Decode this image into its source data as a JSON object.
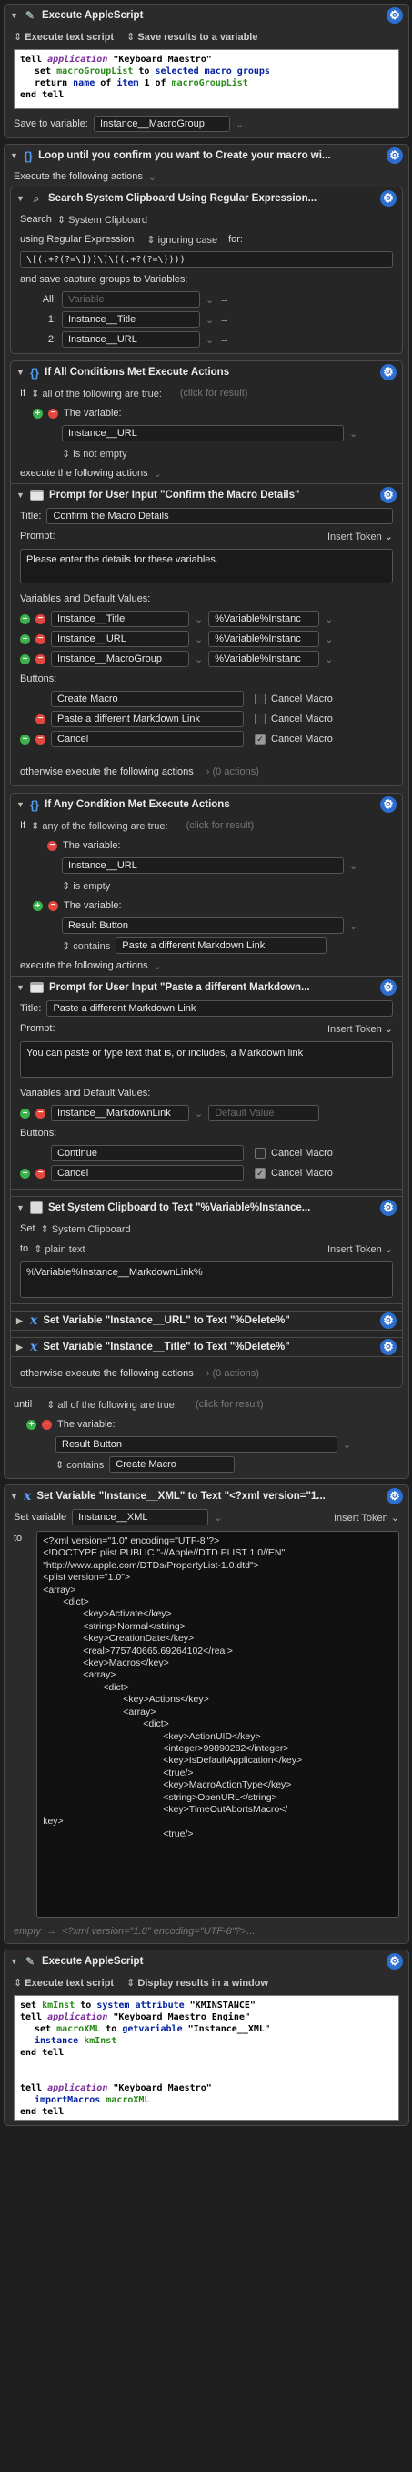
{
  "a1": {
    "title": "Execute AppleScript",
    "opt1": "Execute text script",
    "opt2": "Save results to a variable",
    "save_label": "Save to variable:",
    "save_var": "Instance__MacroGroup",
    "code": [
      "tell application \"Keyboard Maestro\"",
      "set macroGroupList to selected macro groups",
      "return name of item 1 of macroGroupList",
      "end tell"
    ]
  },
  "loop": {
    "title": "Loop until you confirm you want to Create your macro wi...",
    "exec": "Execute the following actions",
    "until_label": "until",
    "until_mode": "all of the following are true:",
    "click_result": "(click for result)",
    "var_label": "The variable:",
    "var": "Result Button",
    "op": "contains",
    "value": "Create Macro"
  },
  "search": {
    "title": "Search System Clipboard Using Regular Expression...",
    "search_label": "Search",
    "search_src": "System Clipboard",
    "using": "using Regular Expression",
    "ign": "ignoring case",
    "for": "for:",
    "regex": "\\[(.+?(?=\\]))\\]\\((.+?(?=\\))))",
    "save_caps": "and save capture groups to Variables:",
    "all_label": "All:",
    "all_ph": "Variable",
    "n1": "1:",
    "v1": "Instance__Title",
    "n2": "2:",
    "v2": "Instance__URL"
  },
  "if1": {
    "title": "If All Conditions Met Execute Actions",
    "if_label": "If",
    "mode": "all of the following are true:",
    "click": "(click for result)",
    "var_label": "The variable:",
    "var": "Instance__URL",
    "cond": "is not empty",
    "exec": "execute the following actions",
    "otherwise": "otherwise execute the following actions",
    "zero": "(0 actions)"
  },
  "prompt1": {
    "title": "Prompt for User Input \"Confirm the Macro Details\"",
    "title_label": "Title:",
    "title_val": "Confirm the Macro Details",
    "prompt_label": "Prompt:",
    "insert": "Insert Token",
    "prompt_text": "Please enter the details for these variables.",
    "vars_label": "Variables and Default Values:",
    "vars": [
      {
        "n": "Instance__Title",
        "d": "%Variable%Instanc"
      },
      {
        "n": "Instance__URL",
        "d": "%Variable%Instanc"
      },
      {
        "n": "Instance__MacroGroup",
        "d": "%Variable%Instanc"
      }
    ],
    "buttons_label": "Buttons:",
    "buttons": [
      {
        "n": "Create Macro",
        "c": "Cancel Macro",
        "on": false
      },
      {
        "n": "Paste a different Markdown Link",
        "c": "Cancel Macro",
        "on": false
      },
      {
        "n": "Cancel",
        "c": "Cancel Macro",
        "on": true
      }
    ]
  },
  "if2": {
    "title": "If Any Condition Met Execute Actions",
    "if_label": "If",
    "mode": "any of the following are true:",
    "click": "(click for result)",
    "var_label": "The variable:",
    "var1": "Instance__URL",
    "cond1": "is empty",
    "var2": "Result Button",
    "op2": "contains",
    "val2": "Paste a different Markdown Link",
    "exec": "execute the following actions",
    "otherwise": "otherwise execute the following actions",
    "zero": "(0 actions)"
  },
  "prompt2": {
    "title": "Prompt for User Input \"Paste a different Markdown...",
    "title_label": "Title:",
    "title_val": "Paste a different Markdown Link",
    "prompt_label": "Prompt:",
    "insert": "Insert Token",
    "prompt_text": "You can paste or type text that is, or includes, a Markdown link",
    "vars_label": "Variables and Default Values:",
    "var": "Instance__MarkdownLink",
    "def_ph": "Default Value",
    "buttons_label": "Buttons:",
    "buttons": [
      {
        "n": "Continue",
        "c": "Cancel Macro",
        "on": false
      },
      {
        "n": "Cancel",
        "c": "Cancel Macro",
        "on": true
      }
    ]
  },
  "setclip": {
    "title": "Set System Clipboard to Text \"%Variable%Instance...",
    "set_label": "Set",
    "target": "System Clipboard",
    "to": "to",
    "mode": "plain text",
    "insert": "Insert Token",
    "text": "%Variable%Instance__MarkdownLink%"
  },
  "sv1": {
    "title": "Set Variable \"Instance__URL\" to Text \"%Delete%\""
  },
  "sv2": {
    "title": "Set Variable \"Instance__Title\" to Text \"%Delete%\""
  },
  "xmlact": {
    "title": "Set Variable \"Instance__XML\" to Text \"<?xml version=\"1...",
    "set_label": "Set variable",
    "var": "Instance__XML",
    "insert": "Insert Token",
    "to": "to",
    "xml": [
      "<?xml version=\"1.0\" encoding=\"UTF-8\"?>",
      "<!DOCTYPE plist PUBLIC \"-//Apple//DTD PLIST 1.0//EN\"",
      "\"http://www.apple.com/DTDs/PropertyList-1.0.dtd\">",
      "<plist version=\"1.0\">",
      "<array>",
      "\t<dict>",
      "\t\t<key>Activate</key>",
      "\t\t<string>Normal</string>",
      "\t\t<key>CreationDate</key>",
      "\t\t<real>775740665.69264102</real>",
      "\t\t<key>Macros</key>",
      "\t\t<array>",
      "\t\t\t<dict>",
      "\t\t\t\t<key>Actions</key>",
      "\t\t\t\t<array>",
      "\t\t\t\t\t<dict>",
      "\t\t\t\t\t\t<key>ActionUID</key>",
      "\t\t\t\t\t\t<integer>99890282</integer>",
      "\t\t\t\t\t\t<key>IsDefaultApplication</key>",
      "\t\t\t\t\t\t<true/>",
      "\t\t\t\t\t\t<key>MacroActionType</key>",
      "\t\t\t\t\t\t<string>OpenURL</string>",
      "\t\t\t\t\t\t<key>TimeOutAbortsMacro</",
      "key>",
      "\t\t\t\t\t\t<true/>"
    ],
    "empty": "empty",
    "arrow": "→",
    "xml_summary": "<?xml version=\"1.0\" encoding=\"UTF-8\"?>..."
  },
  "a2": {
    "title": "Execute AppleScript",
    "opt1": "Execute text script",
    "opt2": "Display results in a window",
    "code": [
      "set kmInst to system attribute \"KMINSTANCE\"",
      "tell application \"Keyboard Maestro Engine\"",
      "set macroXML to getvariable \"Instance__XML\"",
      "instance kmInst",
      "end tell",
      "",
      "",
      "tell application \"Keyboard Maestro\"",
      "importMacros macroXML",
      "end tell"
    ]
  },
  "icons": {
    "gear": "gear-icon",
    "applescript": "script-icon",
    "loop": "loop-braces-icon",
    "regex": "search-icon",
    "if": "if-braces-icon",
    "prompt": "window-icon",
    "clipboard": "clipboard-icon",
    "variable": "variable-x-icon"
  }
}
